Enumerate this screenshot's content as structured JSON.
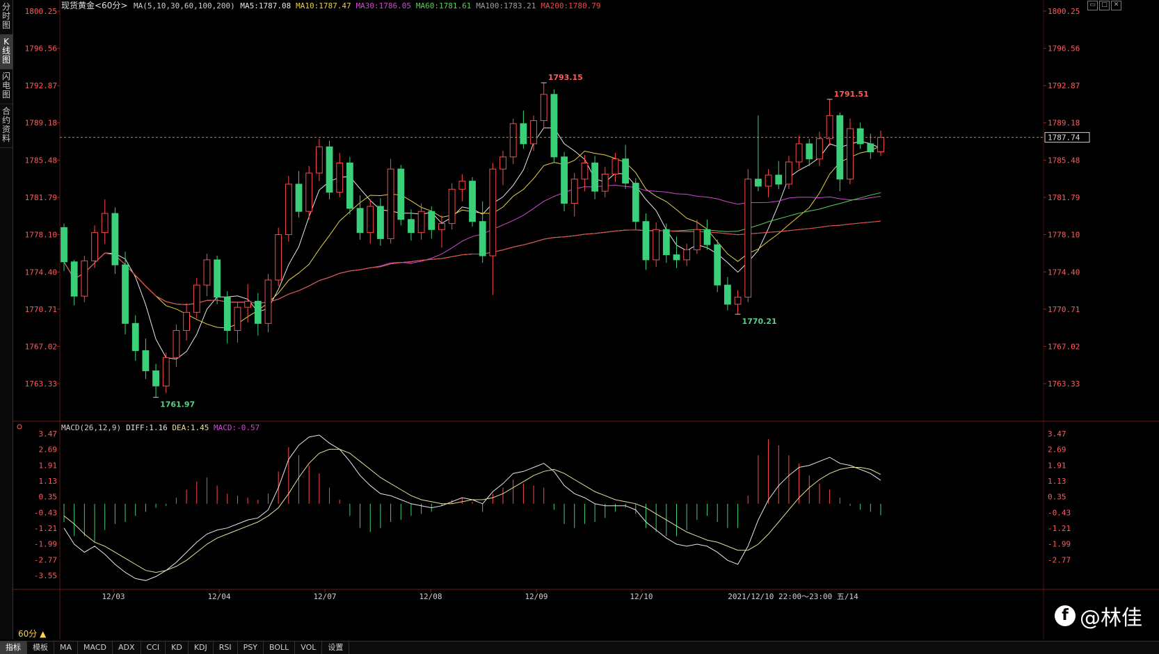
{
  "instrument": "现货黄金",
  "period": "60分",
  "left_tabs": [
    "分时图",
    "K线图",
    "闪电图",
    "合约资料"
  ],
  "active_left_tab": 1,
  "main_legend": [
    {
      "label": "MA(5,10,30,60,100,200)",
      "color": "#d0d0d0"
    },
    {
      "label": "MA5:1787.08",
      "color": "#e8e8e8"
    },
    {
      "label": "MA10:1787.47",
      "color": "#e8d04a"
    },
    {
      "label": "MA30:1786.05",
      "color": "#d04ad0"
    },
    {
      "label": "MA60:1781.61",
      "color": "#5ad05a"
    },
    {
      "label": "MA100:1783.21",
      "color": "#a0a0a0"
    },
    {
      "label": "MA200:1780.79",
      "color": "#e84a4a"
    }
  ],
  "macd_legend": [
    {
      "label": "MACD(26,12,9)",
      "color": "#d0d0d0"
    },
    {
      "label": "DIFF:1.16",
      "color": "#e8e8e8"
    },
    {
      "label": "DEA:1.45",
      "color": "#e8e0a0"
    },
    {
      "label": "MACD:-0.57",
      "color": "#d04ad0"
    }
  ],
  "price_ticks": [
    "1800.25",
    "1796.56",
    "1792.87",
    "1789.18",
    "1785.48",
    "1781.79",
    "1778.10",
    "1774.40",
    "1770.71",
    "1767.02",
    "1763.33"
  ],
  "macd_ticks": [
    "3.47",
    "2.69",
    "1.91",
    "1.13",
    "0.35",
    "-0.43",
    "-1.21",
    "-1.99",
    "-2.77",
    "-3.55"
  ],
  "macd_ticks_right": [
    "3.47",
    "2.69",
    "1.91",
    "1.13",
    "0.35",
    "-0.43",
    "-1.21",
    "-1.99",
    "-2.77"
  ],
  "date_labels": [
    "12/03",
    "12/04",
    "12/07",
    "12/08",
    "12/09",
    "12/10"
  ],
  "cursor_info": "2021/12/10 22:00～23:00 五/14",
  "annotations": [
    {
      "text": "1793.15",
      "color": "#ff5c5c"
    },
    {
      "text": "1791.51",
      "color": "#ff5c5c"
    },
    {
      "text": "1761.97",
      "color": "#5ad08a"
    },
    {
      "text": "1770.21",
      "color": "#5ad08a"
    }
  ],
  "current_price": "1787.74",
  "bottom_tabs": [
    "指标",
    "模板",
    "MA",
    "MACD",
    "ADX",
    "CCI",
    "KD",
    "KDJ",
    "RSI",
    "PSY",
    "BOLL",
    "VOL",
    "设置"
  ],
  "active_bottom_tab": 0,
  "period_button": "60分 ▲",
  "watermark": "@林佳",
  "colors": {
    "up": "#ff4a4a",
    "down": "#3ad07a",
    "bg": "#000000",
    "grid": "#4a1010"
  },
  "chart_data": {
    "type": "candlestick",
    "price_range": [
      1760.5,
      1800.25
    ],
    "macd_range": [
      -4.2,
      3.8
    ],
    "candles": [
      {
        "o": 1778.8,
        "h": 1779.2,
        "l": 1774.5,
        "c": 1775.4
      },
      {
        "o": 1775.4,
        "h": 1775.6,
        "l": 1771.1,
        "c": 1772.0
      },
      {
        "o": 1772.0,
        "h": 1776.0,
        "l": 1771.4,
        "c": 1775.5
      },
      {
        "o": 1775.5,
        "h": 1779.0,
        "l": 1774.8,
        "c": 1778.3
      },
      {
        "o": 1778.3,
        "h": 1781.6,
        "l": 1777.2,
        "c": 1780.2
      },
      {
        "o": 1780.2,
        "h": 1780.8,
        "l": 1774.2,
        "c": 1775.1
      },
      {
        "o": 1775.1,
        "h": 1776.4,
        "l": 1768.2,
        "c": 1769.3
      },
      {
        "o": 1769.3,
        "h": 1770.1,
        "l": 1765.6,
        "c": 1766.6
      },
      {
        "o": 1766.6,
        "h": 1767.8,
        "l": 1763.8,
        "c": 1764.6
      },
      {
        "o": 1764.6,
        "h": 1765.3,
        "l": 1761.97,
        "c": 1763.1
      },
      {
        "o": 1763.1,
        "h": 1766.4,
        "l": 1762.4,
        "c": 1765.9
      },
      {
        "o": 1765.9,
        "h": 1769.2,
        "l": 1765.0,
        "c": 1768.6
      },
      {
        "o": 1768.6,
        "h": 1771.3,
        "l": 1767.6,
        "c": 1770.4
      },
      {
        "o": 1770.4,
        "h": 1773.8,
        "l": 1769.8,
        "c": 1773.1
      },
      {
        "o": 1773.1,
        "h": 1776.2,
        "l": 1772.0,
        "c": 1775.6
      },
      {
        "o": 1775.6,
        "h": 1776.0,
        "l": 1771.2,
        "c": 1771.9
      },
      {
        "o": 1771.9,
        "h": 1772.5,
        "l": 1767.3,
        "c": 1768.6
      },
      {
        "o": 1768.6,
        "h": 1771.4,
        "l": 1767.4,
        "c": 1770.9
      },
      {
        "o": 1770.9,
        "h": 1773.2,
        "l": 1769.4,
        "c": 1771.5
      },
      {
        "o": 1771.5,
        "h": 1772.3,
        "l": 1768.1,
        "c": 1769.3
      },
      {
        "o": 1769.3,
        "h": 1774.2,
        "l": 1768.4,
        "c": 1773.6
      },
      {
        "o": 1773.6,
        "h": 1778.8,
        "l": 1773.0,
        "c": 1778.1
      },
      {
        "o": 1778.1,
        "h": 1783.9,
        "l": 1777.4,
        "c": 1783.1
      },
      {
        "o": 1783.1,
        "h": 1784.4,
        "l": 1779.8,
        "c": 1780.4
      },
      {
        "o": 1780.4,
        "h": 1784.9,
        "l": 1779.6,
        "c": 1784.2
      },
      {
        "o": 1784.2,
        "h": 1787.6,
        "l": 1783.4,
        "c": 1786.8
      },
      {
        "o": 1786.8,
        "h": 1787.4,
        "l": 1781.6,
        "c": 1782.3
      },
      {
        "o": 1782.3,
        "h": 1786.2,
        "l": 1781.8,
        "c": 1785.2
      },
      {
        "o": 1785.2,
        "h": 1785.8,
        "l": 1780.1,
        "c": 1780.7
      },
      {
        "o": 1780.7,
        "h": 1782.0,
        "l": 1777.6,
        "c": 1778.3
      },
      {
        "o": 1778.3,
        "h": 1781.6,
        "l": 1777.2,
        "c": 1780.9
      },
      {
        "o": 1780.9,
        "h": 1781.7,
        "l": 1777.0,
        "c": 1777.7
      },
      {
        "o": 1777.7,
        "h": 1785.6,
        "l": 1777.2,
        "c": 1784.6
      },
      {
        "o": 1784.6,
        "h": 1785.0,
        "l": 1779.0,
        "c": 1779.6
      },
      {
        "o": 1779.6,
        "h": 1780.6,
        "l": 1777.5,
        "c": 1778.3
      },
      {
        "o": 1778.3,
        "h": 1781.2,
        "l": 1777.6,
        "c": 1780.4
      },
      {
        "o": 1780.4,
        "h": 1780.9,
        "l": 1777.7,
        "c": 1778.6
      },
      {
        "o": 1778.6,
        "h": 1780.0,
        "l": 1776.8,
        "c": 1779.2
      },
      {
        "o": 1779.2,
        "h": 1783.2,
        "l": 1778.6,
        "c": 1782.6
      },
      {
        "o": 1782.6,
        "h": 1784.1,
        "l": 1781.4,
        "c": 1783.4
      },
      {
        "o": 1783.4,
        "h": 1783.8,
        "l": 1778.9,
        "c": 1779.4
      },
      {
        "o": 1779.4,
        "h": 1781.4,
        "l": 1775.3,
        "c": 1776.0
      },
      {
        "o": 1776.0,
        "h": 1785.2,
        "l": 1772.1,
        "c": 1784.6
      },
      {
        "o": 1784.6,
        "h": 1786.4,
        "l": 1783.0,
        "c": 1785.8
      },
      {
        "o": 1785.8,
        "h": 1789.6,
        "l": 1785.1,
        "c": 1789.1
      },
      {
        "o": 1789.1,
        "h": 1790.4,
        "l": 1786.6,
        "c": 1787.1
      },
      {
        "o": 1787.1,
        "h": 1789.9,
        "l": 1786.4,
        "c": 1789.4
      },
      {
        "o": 1789.4,
        "h": 1793.15,
        "l": 1788.6,
        "c": 1792.0
      },
      {
        "o": 1792.0,
        "h": 1792.5,
        "l": 1785.2,
        "c": 1785.8
      },
      {
        "o": 1785.8,
        "h": 1786.3,
        "l": 1780.4,
        "c": 1781.2
      },
      {
        "o": 1781.2,
        "h": 1784.2,
        "l": 1779.9,
        "c": 1783.6
      },
      {
        "o": 1783.6,
        "h": 1786.0,
        "l": 1782.4,
        "c": 1785.2
      },
      {
        "o": 1785.2,
        "h": 1785.9,
        "l": 1781.6,
        "c": 1782.4
      },
      {
        "o": 1782.4,
        "h": 1784.8,
        "l": 1781.8,
        "c": 1784.1
      },
      {
        "o": 1784.1,
        "h": 1786.2,
        "l": 1783.3,
        "c": 1785.6
      },
      {
        "o": 1785.6,
        "h": 1787.0,
        "l": 1782.6,
        "c": 1783.2
      },
      {
        "o": 1783.2,
        "h": 1783.7,
        "l": 1778.6,
        "c": 1779.4
      },
      {
        "o": 1779.4,
        "h": 1780.2,
        "l": 1774.6,
        "c": 1775.6
      },
      {
        "o": 1775.6,
        "h": 1779.3,
        "l": 1774.9,
        "c": 1778.6
      },
      {
        "o": 1778.6,
        "h": 1779.2,
        "l": 1775.3,
        "c": 1776.1
      },
      {
        "o": 1776.1,
        "h": 1777.9,
        "l": 1774.8,
        "c": 1775.6
      },
      {
        "o": 1775.6,
        "h": 1777.2,
        "l": 1775.0,
        "c": 1776.6
      },
      {
        "o": 1776.6,
        "h": 1779.6,
        "l": 1776.2,
        "c": 1778.6
      },
      {
        "o": 1778.6,
        "h": 1779.6,
        "l": 1776.6,
        "c": 1777.1
      },
      {
        "o": 1777.1,
        "h": 1777.6,
        "l": 1772.4,
        "c": 1773.1
      },
      {
        "o": 1773.1,
        "h": 1773.9,
        "l": 1770.6,
        "c": 1771.2
      },
      {
        "o": 1771.2,
        "h": 1772.6,
        "l": 1770.21,
        "c": 1771.9
      },
      {
        "o": 1771.9,
        "h": 1784.6,
        "l": 1771.4,
        "c": 1783.6
      },
      {
        "o": 1783.6,
        "h": 1789.9,
        "l": 1782.4,
        "c": 1782.9
      },
      {
        "o": 1782.9,
        "h": 1784.6,
        "l": 1781.8,
        "c": 1784.0
      },
      {
        "o": 1784.0,
        "h": 1785.4,
        "l": 1782.6,
        "c": 1783.1
      },
      {
        "o": 1783.1,
        "h": 1785.9,
        "l": 1782.6,
        "c": 1785.3
      },
      {
        "o": 1785.3,
        "h": 1787.9,
        "l": 1784.6,
        "c": 1787.1
      },
      {
        "o": 1787.1,
        "h": 1787.6,
        "l": 1784.9,
        "c": 1785.6
      },
      {
        "o": 1785.6,
        "h": 1788.3,
        "l": 1784.9,
        "c": 1787.6
      },
      {
        "o": 1787.6,
        "h": 1791.51,
        "l": 1786.9,
        "c": 1789.9
      },
      {
        "o": 1789.9,
        "h": 1790.2,
        "l": 1782.4,
        "c": 1783.6
      },
      {
        "o": 1783.6,
        "h": 1789.6,
        "l": 1783.1,
        "c": 1788.6
      },
      {
        "o": 1788.6,
        "h": 1789.2,
        "l": 1786.6,
        "c": 1787.1
      },
      {
        "o": 1787.1,
        "h": 1788.1,
        "l": 1785.6,
        "c": 1786.3
      },
      {
        "o": 1786.3,
        "h": 1788.4,
        "l": 1785.9,
        "c": 1787.74
      }
    ],
    "macd": [
      {
        "diff": -1.2,
        "dea": -0.6,
        "hist": -0.9
      },
      {
        "diff": -2.0,
        "dea": -1.0,
        "hist": -1.6
      },
      {
        "diff": -2.4,
        "dea": -1.5,
        "hist": -1.6
      },
      {
        "diff": -2.1,
        "dea": -1.9,
        "hist": -1.9
      },
      {
        "diff": -2.5,
        "dea": -2.1,
        "hist": -1.3
      },
      {
        "diff": -3.0,
        "dea": -2.4,
        "hist": -1.0
      },
      {
        "diff": -3.4,
        "dea": -2.7,
        "hist": -0.9
      },
      {
        "diff": -3.7,
        "dea": -3.0,
        "hist": -0.6
      },
      {
        "diff": -3.8,
        "dea": -3.3,
        "hist": -0.4
      },
      {
        "diff": -3.6,
        "dea": -3.4,
        "hist": -0.2
      },
      {
        "diff": -3.3,
        "dea": -3.3,
        "hist": -0.1
      },
      {
        "diff": -2.9,
        "dea": -3.1,
        "hist": 0.3
      },
      {
        "diff": -2.4,
        "dea": -2.8,
        "hist": 0.7
      },
      {
        "diff": -1.9,
        "dea": -2.4,
        "hist": 1.1
      },
      {
        "diff": -1.5,
        "dea": -2.0,
        "hist": 1.3
      },
      {
        "diff": -1.3,
        "dea": -1.7,
        "hist": 0.9
      },
      {
        "diff": -1.2,
        "dea": -1.5,
        "hist": 0.5
      },
      {
        "diff": -1.0,
        "dea": -1.3,
        "hist": 0.4
      },
      {
        "diff": -0.8,
        "dea": -1.1,
        "hist": 0.3
      },
      {
        "diff": -0.7,
        "dea": -0.9,
        "hist": 0.2
      },
      {
        "diff": -0.3,
        "dea": -0.6,
        "hist": 0.5
      },
      {
        "diff": 0.8,
        "dea": -0.2,
        "hist": 1.6
      },
      {
        "diff": 2.2,
        "dea": 0.5,
        "hist": 2.8
      },
      {
        "diff": 2.9,
        "dea": 1.3,
        "hist": 2.4
      },
      {
        "diff": 3.3,
        "dea": 2.0,
        "hist": 1.9
      },
      {
        "diff": 3.4,
        "dea": 2.5,
        "hist": 1.5
      },
      {
        "diff": 3.0,
        "dea": 2.7,
        "hist": 0.8
      },
      {
        "diff": 2.7,
        "dea": 2.7,
        "hist": 0.2
      },
      {
        "diff": 2.1,
        "dea": 2.5,
        "hist": -0.6
      },
      {
        "diff": 1.4,
        "dea": 2.1,
        "hist": -1.2
      },
      {
        "diff": 0.9,
        "dea": 1.7,
        "hist": -1.4
      },
      {
        "diff": 0.5,
        "dea": 1.3,
        "hist": -1.2
      },
      {
        "diff": 0.4,
        "dea": 1.0,
        "hist": -0.9
      },
      {
        "diff": 0.2,
        "dea": 0.7,
        "hist": -0.8
      },
      {
        "diff": 0.0,
        "dea": 0.4,
        "hist": -0.6
      },
      {
        "diff": -0.1,
        "dea": 0.2,
        "hist": -0.5
      },
      {
        "diff": -0.2,
        "dea": 0.1,
        "hist": -0.4
      },
      {
        "diff": -0.1,
        "dea": 0.0,
        "hist": -0.1
      },
      {
        "diff": 0.1,
        "dea": 0.0,
        "hist": 0.2
      },
      {
        "diff": 0.3,
        "dea": 0.1,
        "hist": 0.3
      },
      {
        "diff": 0.2,
        "dea": 0.2,
        "hist": 0.1
      },
      {
        "diff": 0.0,
        "dea": 0.2,
        "hist": -0.4
      },
      {
        "diff": 0.6,
        "dea": 0.3,
        "hist": 0.5
      },
      {
        "diff": 1.0,
        "dea": 0.5,
        "hist": 0.8
      },
      {
        "diff": 1.5,
        "dea": 0.8,
        "hist": 1.2
      },
      {
        "diff": 1.6,
        "dea": 1.1,
        "hist": 1.0
      },
      {
        "diff": 1.8,
        "dea": 1.4,
        "hist": 0.9
      },
      {
        "diff": 2.0,
        "dea": 1.6,
        "hist": 0.8
      },
      {
        "diff": 1.6,
        "dea": 1.7,
        "hist": -0.3
      },
      {
        "diff": 0.9,
        "dea": 1.5,
        "hist": -1.0
      },
      {
        "diff": 0.5,
        "dea": 1.2,
        "hist": -1.2
      },
      {
        "diff": 0.3,
        "dea": 0.9,
        "hist": -1.0
      },
      {
        "diff": 0.0,
        "dea": 0.6,
        "hist": -0.9
      },
      {
        "diff": -0.1,
        "dea": 0.4,
        "hist": -0.7
      },
      {
        "diff": -0.1,
        "dea": 0.2,
        "hist": -0.4
      },
      {
        "diff": -0.1,
        "dea": 0.1,
        "hist": -0.2
      },
      {
        "diff": -0.3,
        "dea": 0.0,
        "hist": -0.5
      },
      {
        "diff": -0.9,
        "dea": -0.2,
        "hist": -1.2
      },
      {
        "diff": -1.3,
        "dea": -0.5,
        "hist": -1.4
      },
      {
        "diff": -1.7,
        "dea": -0.8,
        "hist": -1.6
      },
      {
        "diff": -2.0,
        "dea": -1.1,
        "hist": -1.6
      },
      {
        "diff": -2.1,
        "dea": -1.4,
        "hist": -1.3
      },
      {
        "diff": -2.0,
        "dea": -1.6,
        "hist": -0.8
      },
      {
        "diff": -2.1,
        "dea": -1.8,
        "hist": -0.6
      },
      {
        "diff": -2.4,
        "dea": -1.9,
        "hist": -0.9
      },
      {
        "diff": -2.8,
        "dea": -2.1,
        "hist": -1.2
      },
      {
        "diff": -3.0,
        "dea": -2.3,
        "hist": -1.2
      },
      {
        "diff": -2.1,
        "dea": -2.3,
        "hist": 0.4
      },
      {
        "diff": -0.8,
        "dea": -2.0,
        "hist": 2.4
      },
      {
        "diff": 0.2,
        "dea": -1.5,
        "hist": 3.2
      },
      {
        "diff": 0.9,
        "dea": -0.9,
        "hist": 2.9
      },
      {
        "diff": 1.4,
        "dea": -0.3,
        "hist": 2.4
      },
      {
        "diff": 1.8,
        "dea": 0.3,
        "hist": 2.0
      },
      {
        "diff": 1.9,
        "dea": 0.8,
        "hist": 1.4
      },
      {
        "diff": 2.1,
        "dea": 1.2,
        "hist": 1.0
      },
      {
        "diff": 2.3,
        "dea": 1.5,
        "hist": 0.7
      },
      {
        "diff": 2.0,
        "dea": 1.7,
        "hist": 0.3
      },
      {
        "diff": 1.9,
        "dea": 1.8,
        "hist": -0.1
      },
      {
        "diff": 1.7,
        "dea": 1.8,
        "hist": -0.3
      },
      {
        "diff": 1.5,
        "dea": 1.7,
        "hist": -0.4
      },
      {
        "diff": 1.16,
        "dea": 1.45,
        "hist": -0.57
      }
    ]
  }
}
